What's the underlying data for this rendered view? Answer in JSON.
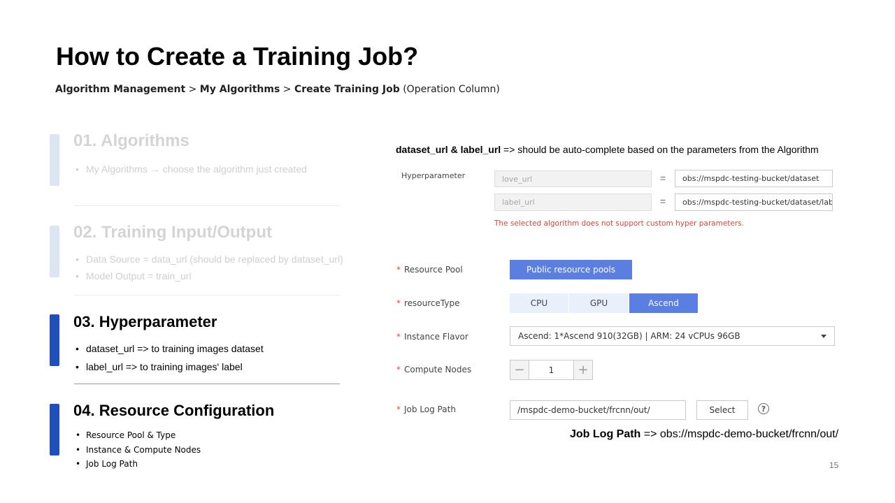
{
  "slide": {
    "title": "How to Create a Training Job?",
    "breadcrumb": {
      "part1": "Algorithm Management",
      "sep1": " > ",
      "part2": "My Algorithms",
      "sep2": " > ",
      "part3": "Create Training Job",
      "suffix": " (Operation Column)"
    },
    "page_number": "15"
  },
  "sections": [
    {
      "title": "01. Algorithms",
      "bullets": [
        "My Algorithms → choose the algorithm just created"
      ],
      "active": false
    },
    {
      "title": "02. Training Input/Output",
      "bullets": [
        "Data Source = data_url (should be replaced by dataset_url)",
        "Model Output = train_url"
      ],
      "active": false
    },
    {
      "title": "03. Hyperparameter",
      "bullets": [
        "dataset_url => to training images dataset",
        "label_url => to training images' label"
      ],
      "active": true
    },
    {
      "title": "04. Resource Configuration",
      "bullets": [
        "Resource Pool & Type",
        "Instance & Compute Nodes",
        "Job Log Path"
      ],
      "active": true
    }
  ],
  "notes": {
    "top_bold": "dataset_url & label_url",
    "top_rest": " => should be auto-complete based on the parameters from the Algorithm",
    "log_bold": "Job Log Path",
    "log_rest": " => obs://mspdc-demo-bucket/frcnn/out/"
  },
  "form": {
    "hyperparameter_label": "Hyperparameter",
    "params": [
      {
        "name": "love_url",
        "equals": "=",
        "value": "obs://mspdc-testing-bucket/dataset"
      },
      {
        "name": "label_url",
        "equals": "=",
        "value": "obs://mspdc-testing-bucket/dataset/label/"
      }
    ],
    "hyperparameter_error": "The selected algorithm does not support custom hyper parameters.",
    "required_mark": "*",
    "resource_pool": {
      "label": "Resource Pool",
      "button": "Public resource pools"
    },
    "resource_type": {
      "label": "resourceType",
      "options": [
        "CPU",
        "GPU",
        "Ascend"
      ],
      "selected": "Ascend"
    },
    "instance_flavor": {
      "label": "Instance Flavor",
      "value": "Ascend: 1*Ascend 910(32GB) | ARM: 24 vCPUs 96GB"
    },
    "compute_nodes": {
      "label": "Compute Nodes",
      "minus": "−",
      "value": "1",
      "plus": "+"
    },
    "job_log_path": {
      "label": "Job Log Path",
      "value": "/mspdc-demo-bucket/frcnn/out/",
      "select_button": "Select",
      "help": "?"
    }
  }
}
